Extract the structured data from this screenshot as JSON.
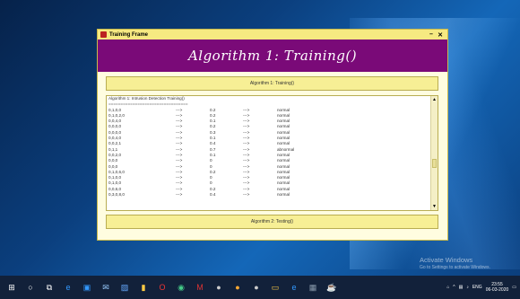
{
  "window": {
    "title": "Training Frame",
    "min": "–",
    "close": "✕"
  },
  "banner": {
    "title": "Algorithm 1: Training()"
  },
  "buttons": {
    "train": "Algorithm 1: Training()",
    "test": "Algorithm 2: Testing()"
  },
  "log": {
    "header_line": "Algorithm 1: Intrusion Detection Training()",
    "separator": "=================================",
    "rows": [
      [
        "0,1,0,0",
        "--->",
        "0.2",
        "--->",
        "normal"
      ],
      [
        "0,1,0,2,0",
        "--->",
        "0.2",
        "--->",
        "normal"
      ],
      [
        "0,0,4,0",
        "--->",
        "0.1",
        "--->",
        "normal"
      ],
      [
        "0,0,0,0",
        "--->",
        "0.2",
        "--->",
        "normal"
      ],
      [
        "0,0,0,0",
        "--->",
        "0.3",
        "--->",
        "normal"
      ],
      [
        "0,0,4,0",
        "--->",
        "0.1",
        "--->",
        "normal"
      ],
      [
        "0,0,2,1",
        "--->",
        "0.4",
        "--->",
        "normal"
      ],
      [
        "0,1,1",
        "--->",
        "0.7",
        "--->",
        "abnormal"
      ],
      [
        "0,0,2,0",
        "--->",
        "0.1",
        "--->",
        "normal"
      ],
      [
        "0,0,0",
        "--->",
        "0",
        "--->",
        "normal"
      ],
      [
        "0,0,0",
        "--->",
        "0",
        "--->",
        "normal"
      ],
      [
        "0,1,0,6,0",
        "--->",
        "0.2",
        "--->",
        "normal"
      ],
      [
        "0,1,0,0",
        "--->",
        "0",
        "--->",
        "normal"
      ],
      [
        "0,1,0,0",
        "--->",
        "0",
        "--->",
        "normal"
      ],
      [
        "0,0,6,0",
        "--->",
        "0.2",
        "--->",
        "normal"
      ],
      [
        "0,3,0,8,0",
        "--->",
        "0.4",
        "--->",
        "normal"
      ]
    ]
  },
  "watermark": {
    "line1": "Activate Windows",
    "line2": "Go to Settings to activate Windows."
  },
  "taskbar": {
    "icons": [
      "windows-icon",
      "search-icon",
      "task-view-icon",
      "edge-icon",
      "store-icon",
      "mail-icon",
      "photos-icon",
      "file-explorer-icon",
      "opera-icon",
      "chrome-icon",
      "gmail-icon",
      "app-icon-1",
      "app-icon-2",
      "app-icon-3",
      "folder-icon",
      "ie-icon",
      "app-icon-4",
      "java-icon"
    ],
    "tray_lang": "ENG",
    "time": "23:55",
    "date": "06-03-2020"
  }
}
